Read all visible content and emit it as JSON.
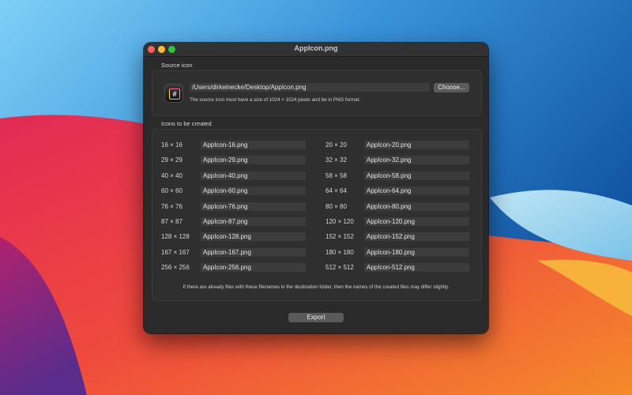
{
  "window": {
    "title": "AppIcon.png"
  },
  "source": {
    "section_label": "Source icon",
    "icon_glyph": "#",
    "path_value": "/Users/dirkeinecke/Desktop/AppIcon.png",
    "choose_label": "Choose...",
    "hint": "The source icon must have a size of 1024 × 1024 pixels and be in PNG format."
  },
  "icons": {
    "section_label": "Icons to be created",
    "left": [
      {
        "size": "16 × 16",
        "name": "AppIcon-16.png"
      },
      {
        "size": "29 × 29",
        "name": "AppIcon-29.png"
      },
      {
        "size": "40 × 40",
        "name": "AppIcon-40.png"
      },
      {
        "size": "60 × 60",
        "name": "AppIcon-60.png"
      },
      {
        "size": "76 × 76",
        "name": "AppIcon-76.png"
      },
      {
        "size": "87 × 87",
        "name": "AppIcon-87.png"
      },
      {
        "size": "128 × 128",
        "name": "AppIcon-128.png"
      },
      {
        "size": "167 × 167",
        "name": "AppIcon-167.png"
      },
      {
        "size": "256 × 256",
        "name": "AppIcon-256.png"
      }
    ],
    "right": [
      {
        "size": "20 × 20",
        "name": "AppIcon-20.png"
      },
      {
        "size": "32 × 32",
        "name": "AppIcon-32.png"
      },
      {
        "size": "58 × 58",
        "name": "AppIcon-58.png"
      },
      {
        "size": "64 × 64",
        "name": "AppIcon-64.png"
      },
      {
        "size": "80 × 80",
        "name": "AppIcon-80.png"
      },
      {
        "size": "120 × 120",
        "name": "AppIcon-120.png"
      },
      {
        "size": "152 × 152",
        "name": "AppIcon-152.png"
      },
      {
        "size": "180 × 180",
        "name": "AppIcon-180.png"
      },
      {
        "size": "512 × 512",
        "name": "AppIcon-512.png"
      }
    ],
    "note": "If there are already files with these filenames in the destination folder, then the names of the created files may differ slightly."
  },
  "export_label": "Export",
  "colors": {
    "close": "#ff5f57",
    "minimize": "#febc2e",
    "maximize": "#28c840",
    "window_bg": "#2a2a2a"
  }
}
